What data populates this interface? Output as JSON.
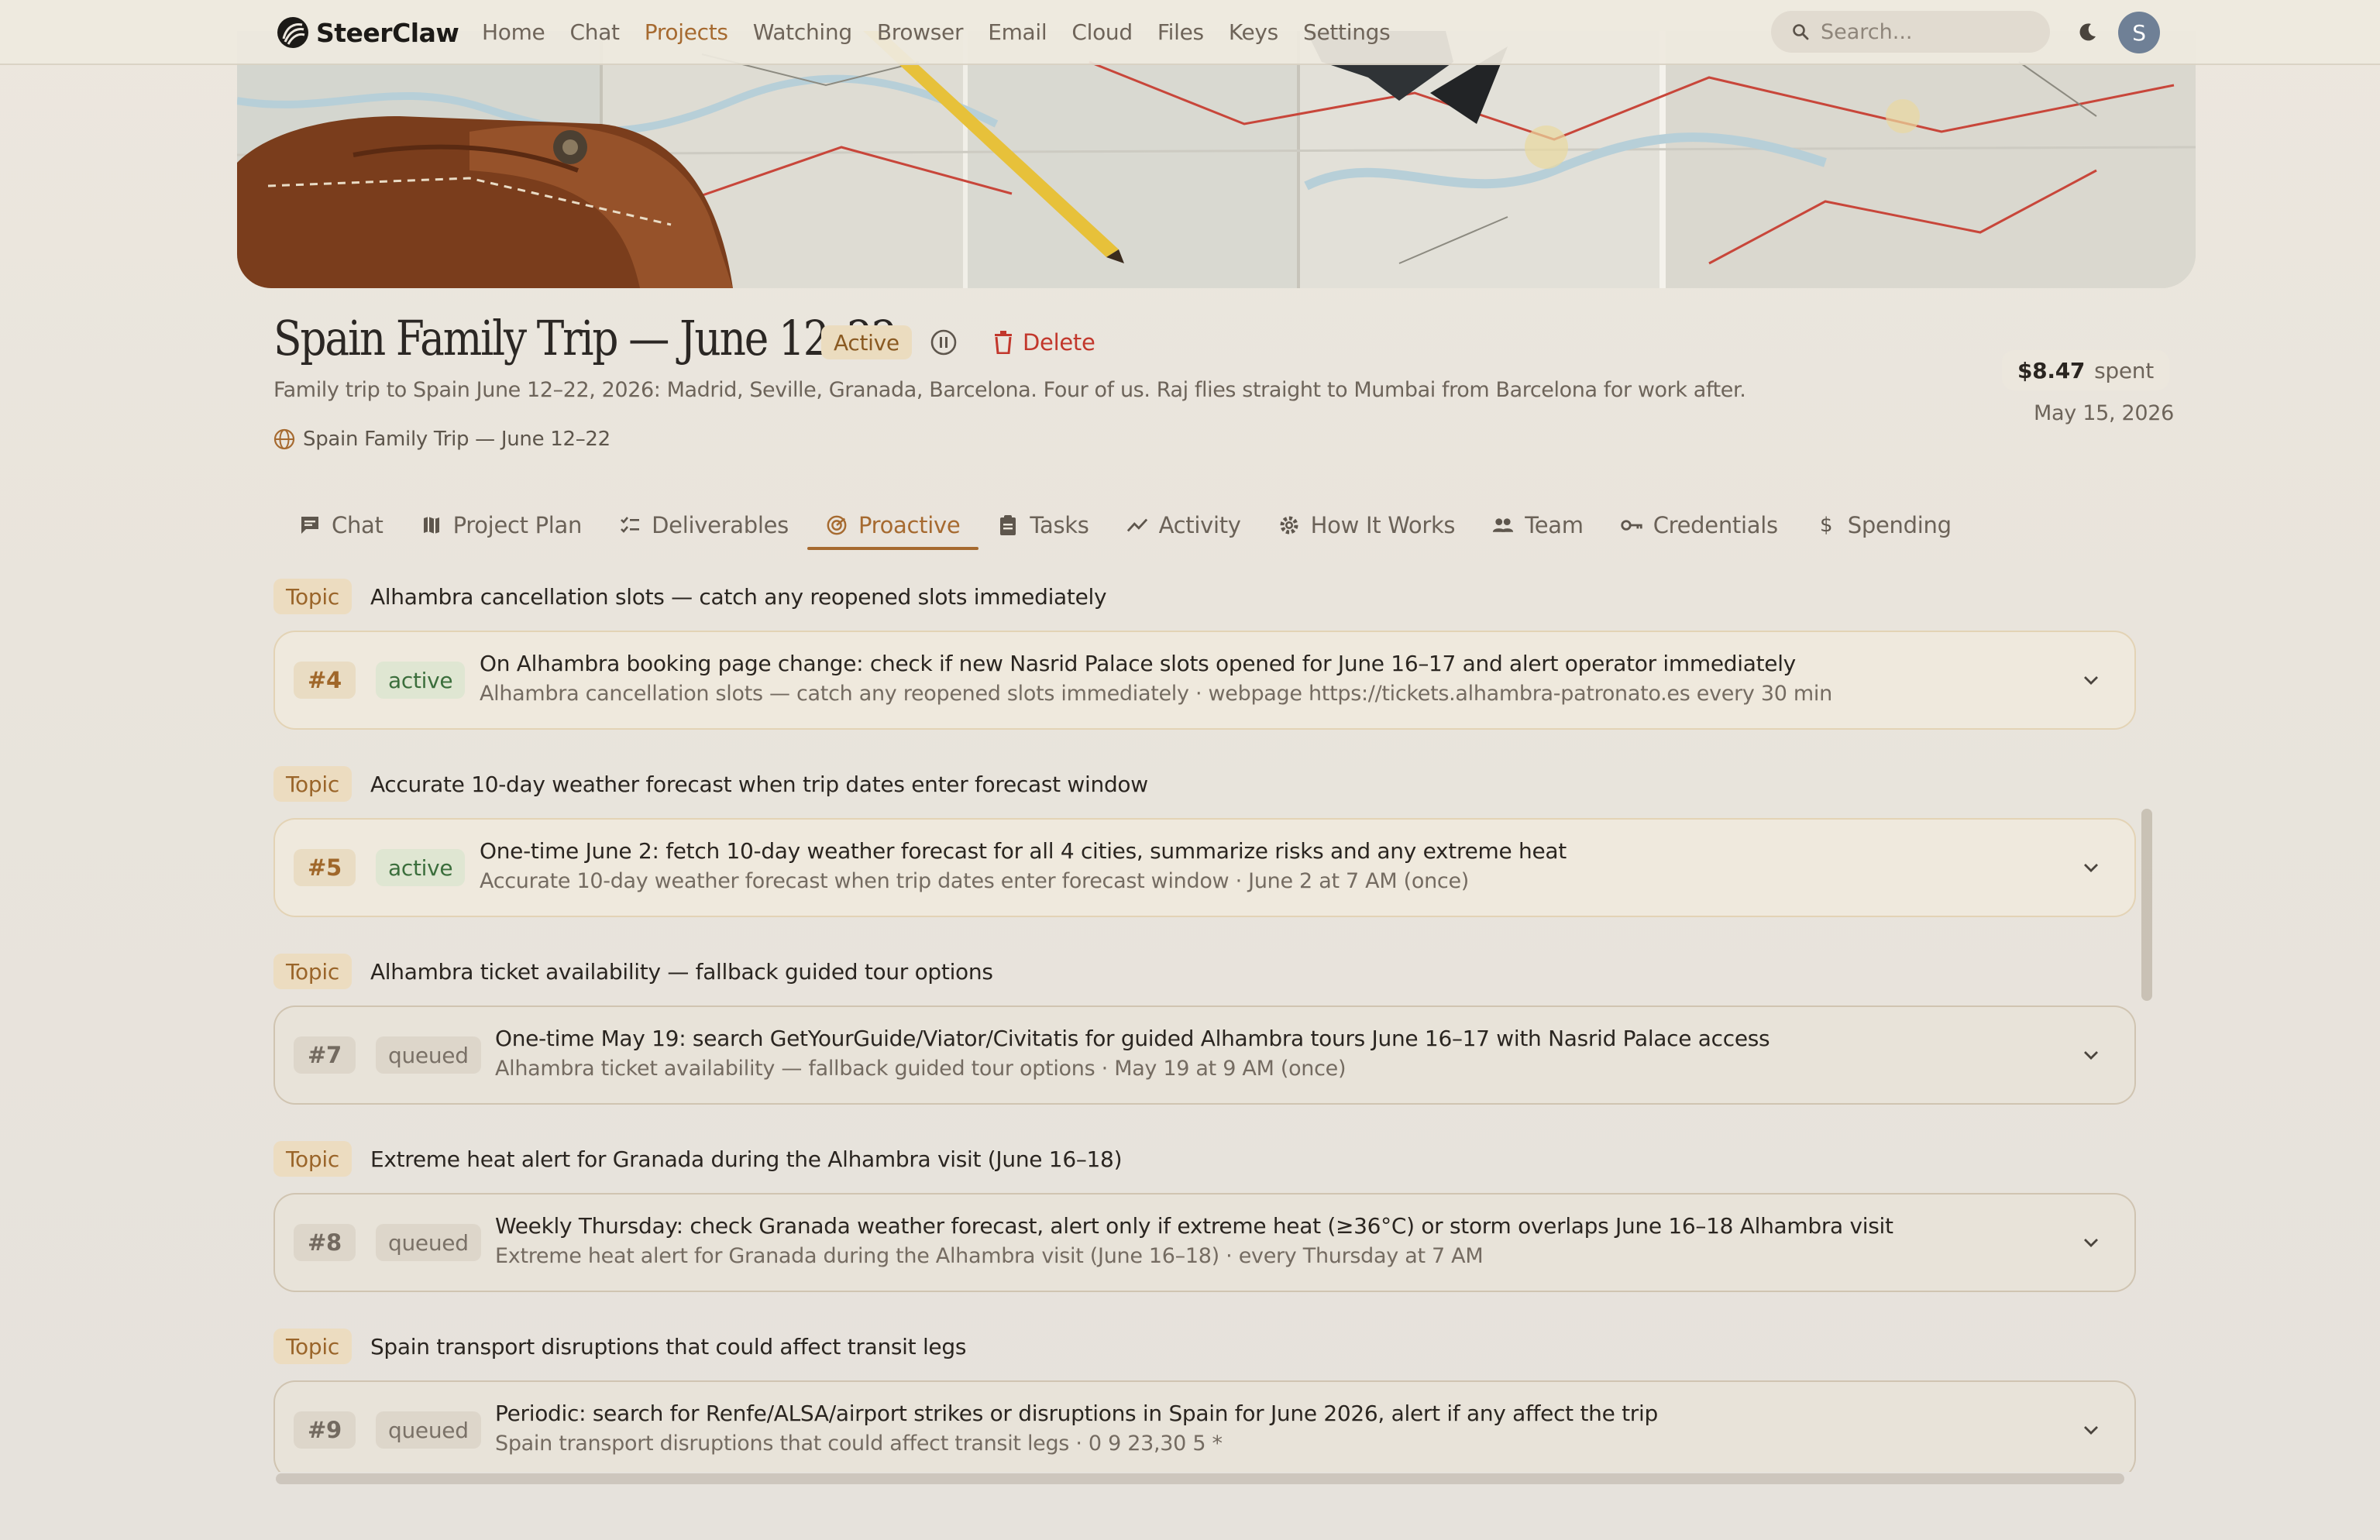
{
  "nav": {
    "brand": "SteerClaw",
    "items": [
      "Home",
      "Chat",
      "Projects",
      "Watching",
      "Browser",
      "Email",
      "Cloud",
      "Files",
      "Keys",
      "Settings"
    ],
    "active_index": 2,
    "search_placeholder": "Search...",
    "avatar_initial": "S"
  },
  "project": {
    "title": "Spain Family Trip — June 12–22",
    "status": "Active",
    "delete_label": "Delete",
    "description": "Family trip to Spain June 12–22, 2026: Madrid, Seville, Granada, Barcelona. Four of us. Raj flies straight to Mumbai from Barcelona for work after.",
    "link_label": "Spain Family Trip — June 12–22",
    "spent_amount": "$8.47",
    "spent_label": "spent",
    "date": "May 15, 2026"
  },
  "tabs": [
    {
      "label": "Chat",
      "icon": "chat-icon"
    },
    {
      "label": "Project Plan",
      "icon": "map-icon"
    },
    {
      "label": "Deliverables",
      "icon": "checklist-icon"
    },
    {
      "label": "Proactive",
      "icon": "radar-icon"
    },
    {
      "label": "Tasks",
      "icon": "clipboard-icon"
    },
    {
      "label": "Activity",
      "icon": "trend-icon"
    },
    {
      "label": "How It Works",
      "icon": "gear-icon"
    },
    {
      "label": "Team",
      "icon": "people-icon"
    },
    {
      "label": "Credentials",
      "icon": "key-icon"
    },
    {
      "label": "Spending",
      "icon": "dollar-icon"
    }
  ],
  "active_tab_index": 3,
  "topic_tag": "Topic",
  "topics": [
    {
      "title": "Alhambra cancellation slots — catch any reopened slots immediately",
      "id": "#4",
      "status": "active",
      "main": "On Alhambra booking page change: check if new Nasrid Palace slots opened for June 16–17 and alert operator immediately",
      "sub": "Alhambra cancellation slots — catch any reopened slots immediately · webpage https://tickets.alhambra-patronato.es every 30 min"
    },
    {
      "title": "Accurate 10-day weather forecast when trip dates enter forecast window",
      "id": "#5",
      "status": "active",
      "main": "One-time June 2: fetch 10-day weather forecast for all 4 cities, summarize risks and any extreme heat",
      "sub": "Accurate 10-day weather forecast when trip dates enter forecast window · June 2 at 7 AM (once)"
    },
    {
      "title": "Alhambra ticket availability — fallback guided tour options",
      "id": "#7",
      "status": "queued",
      "main": "One-time May 19: search GetYourGuide/Viator/Civitatis for guided Alhambra tours June 16–17 with Nasrid Palace access",
      "sub": "Alhambra ticket availability — fallback guided tour options · May 19 at 9 AM (once)"
    },
    {
      "title": "Extreme heat alert for Granada during the Alhambra visit (June 16–18)",
      "id": "#8",
      "status": "queued",
      "main": "Weekly Thursday: check Granada weather forecast, alert only if extreme heat (≥36°C) or storm overlaps June 16–18 Alhambra visit",
      "sub": "Extreme heat alert for Granada during the Alhambra visit (June 16–18) · every Thursday at 7 AM"
    },
    {
      "title": "Spain transport disruptions that could affect transit legs",
      "id": "#9",
      "status": "queued",
      "main": "Periodic: search for Renfe/ALSA/airport strikes or disruptions in Spain for June 2026, alert if any affect the trip",
      "sub": "Spain transport disruptions that could affect transit legs · 0 9 23,30 5 *"
    }
  ]
}
